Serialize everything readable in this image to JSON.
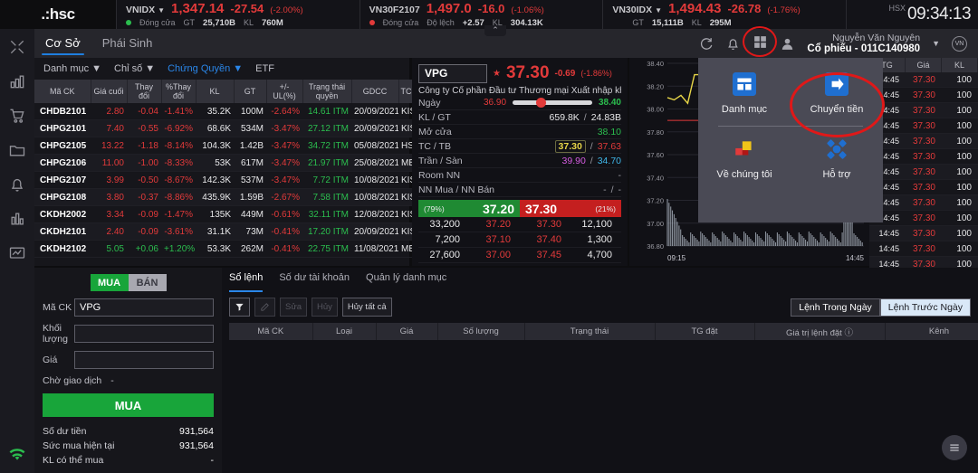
{
  "brand": {
    "logo": ".:hsc"
  },
  "indices": [
    {
      "name": "VNIDX",
      "value": "1,347.14",
      "change": "-27.54",
      "pct": "(-2.00%)",
      "status": "Đóng cửa",
      "status_color": "#2bbd4e",
      "m1_label": "GT",
      "m1_value": "25,710B",
      "m2_label": "KL",
      "m2_value": "760M",
      "dir": "down"
    },
    {
      "name": "VN30F2107",
      "value": "1,497.0",
      "change": "-16.0",
      "pct": "(-1.06%)",
      "status": "Đóng cửa",
      "status_color": "#e23a3a",
      "m1_label": "Độ lệch",
      "m1_value": "+2.57",
      "m2_label": "KL",
      "m2_value": "304.13K",
      "dir": "down"
    },
    {
      "name": "VN30IDX",
      "value": "1,494.43",
      "change": "-26.78",
      "pct": "(-1.76%)",
      "status": "",
      "status_color": "",
      "m1_label": "GT",
      "m1_value": "15,111B",
      "m2_label": "KL",
      "m2_value": "295M",
      "dir": "down"
    }
  ],
  "clock": {
    "exchange": "HSX",
    "time": "09:34:13"
  },
  "rail_icons": [
    "resize-icon",
    "chart-bar-icon",
    "cart-icon",
    "folder-icon",
    "bell-icon",
    "stats-icon",
    "monitor-icon",
    "wifi-icon"
  ],
  "header": {
    "tabs": [
      {
        "label": "Cơ Sở",
        "active": true
      },
      {
        "label": "Phái Sinh",
        "active": false
      }
    ],
    "account_name": "Nguyễn Văn Nguyên",
    "account_id": "Cổ phiếu - 011C140980",
    "avatar_initials": "VN"
  },
  "watchlist": {
    "tabs": [
      {
        "label": "Danh mục",
        "active": false,
        "caret": true
      },
      {
        "label": "Chỉ số",
        "active": false,
        "caret": true
      },
      {
        "label": "Chứng Quyền",
        "active": true,
        "caret": true
      },
      {
        "label": "ETF",
        "active": false,
        "caret": false
      }
    ],
    "columns": [
      "Mã CK",
      "Giá cuối",
      "Thay đổi",
      "%Thay đổi",
      "KL",
      "GT",
      "+/- UL(%)",
      "Trạng thái quyền",
      "GDCC",
      "TCPH"
    ],
    "rows": [
      {
        "sym": "CHDB2101",
        "last": "2.80",
        "chg": "-0.04",
        "pct": "-1.41%",
        "kl": "35.2K",
        "gt": "100M",
        "ul": "-2.64%",
        "status": "14.61 ITM",
        "gdcc": "20/09/2021",
        "tcph": "KIS",
        "dir": "down"
      },
      {
        "sym": "CHPG2101",
        "last": "7.40",
        "chg": "-0.55",
        "pct": "-6.92%",
        "kl": "68.6K",
        "gt": "534M",
        "ul": "-3.47%",
        "status": "27.12 ITM",
        "gdcc": "20/09/2021",
        "tcph": "KIS",
        "dir": "down"
      },
      {
        "sym": "CHPG2105",
        "last": "13.22",
        "chg": "-1.18",
        "pct": "-8.14%",
        "kl": "104.3K",
        "gt": "1.42B",
        "ul": "-3.47%",
        "status": "34.72 ITM",
        "gdcc": "05/08/2021",
        "tcph": "HSC",
        "dir": "down"
      },
      {
        "sym": "CHPG2106",
        "last": "11.00",
        "chg": "-1.00",
        "pct": "-8.33%",
        "kl": "53K",
        "gt": "617M",
        "ul": "-3.47%",
        "status": "21.97 ITM",
        "gdcc": "25/08/2021",
        "tcph": "MBS",
        "dir": "down"
      },
      {
        "sym": "CHPG2107",
        "last": "3.99",
        "chg": "-0.50",
        "pct": "-8.67%",
        "kl": "142.3K",
        "gt": "537M",
        "ul": "-3.47%",
        "status": "7.72 ITM",
        "gdcc": "10/08/2021",
        "tcph": "KIS",
        "dir": "down"
      },
      {
        "sym": "CHPG2108",
        "last": "3.80",
        "chg": "-0.37",
        "pct": "-8.86%",
        "kl": "435.9K",
        "gt": "1.59B",
        "ul": "-2.67%",
        "status": "7.58 ITM",
        "gdcc": "10/08/2021",
        "tcph": "KIS",
        "dir": "down"
      },
      {
        "sym": "CKDH2002",
        "last": "3.34",
        "chg": "-0.09",
        "pct": "-1.47%",
        "kl": "135K",
        "gt": "449M",
        "ul": "-0.61%",
        "status": "32.11 ITM",
        "gdcc": "12/08/2021",
        "tcph": "KIS",
        "dir": "down"
      },
      {
        "sym": "CKDH2101",
        "last": "2.40",
        "chg": "-0.09",
        "pct": "-3.61%",
        "kl": "31.1K",
        "gt": "73M",
        "ul": "-0.41%",
        "status": "17.20 ITM",
        "gdcc": "20/09/2021",
        "tcph": "KIS",
        "dir": "down"
      },
      {
        "sym": "CKDH2102",
        "last": "5.05",
        "chg": "+0.06",
        "pct": "+1.20%",
        "kl": "53.3K",
        "gt": "262M",
        "ul": "-0.41%",
        "status": "22.75 ITM",
        "gdcc": "11/08/2021",
        "tcph": "MBS",
        "dir": "up"
      }
    ]
  },
  "quote": {
    "symbol": "VPG",
    "price": "37.30",
    "change": "-0.69",
    "pct": "(-1.86%)",
    "company": "Công ty Cổ phần Đầu tư Thương mại Xuất nhập khẩ ...",
    "range_label": "Ngày",
    "range_low": "36.90",
    "range_high": "38.40",
    "range_pos_pct": 29,
    "kl_gt_label": "KL / GT",
    "kl": "659.8K",
    "gt": "24.83B",
    "open_label": "Mở cửa",
    "open": "38.10",
    "tc_tb_label": "TC / TB",
    "tc": "37.30",
    "tb": "37.63",
    "tran_san_label": "Trần / Sàn",
    "tran": "39.90",
    "san": "34.70",
    "room_label": "Room NN",
    "room": "-",
    "nn_label": "NN Mua / NN Bán",
    "nn_mua": "-",
    "nn_ban": "-",
    "bid_pct": "(79%)",
    "bid_price": "37.20",
    "ask_price": "37.30",
    "ask_pct": "(21%)",
    "depth": [
      {
        "bid_vol": "33,200",
        "bid_px": "37.20",
        "ask_px": "37.30",
        "ask_vol": "12,100"
      },
      {
        "bid_vol": "7,200",
        "bid_px": "37.10",
        "ask_px": "37.40",
        "ask_vol": "1,300"
      },
      {
        "bid_vol": "27,600",
        "bid_px": "37.00",
        "ask_px": "37.45",
        "ask_vol": "4,700"
      }
    ]
  },
  "chart_data": {
    "type": "line",
    "title": "",
    "xlabel": "",
    "ylabel": "",
    "x_ticks": [
      "09:15",
      "14:45"
    ],
    "y_ticks": [
      "38.40",
      "38.20",
      "38.00",
      "37.80",
      "37.60",
      "37.40",
      "37.20",
      "37.00",
      "36.80"
    ],
    "ylim": [
      36.8,
      38.4
    ],
    "reference_line": 37.9,
    "series": [
      {
        "name": "Giá",
        "color": "#e8d648",
        "values": [
          38.1,
          38.08,
          38.12,
          38.05,
          38.3,
          38.3,
          38.1,
          38.05,
          38.12,
          38.2,
          38.4,
          38.4,
          38.4,
          37.95,
          38.35,
          38.38,
          38.0,
          37.92,
          37.88,
          37.9,
          37.9,
          37.91,
          37.9,
          37.9,
          37.9,
          37.9,
          37.9,
          37.9,
          37.9,
          37.9
        ]
      }
    ],
    "volume_color": "#b9c3cf",
    "grid": true
  },
  "tape": {
    "columns": [
      "TG",
      "Giá",
      "KL"
    ],
    "rows": [
      {
        "time": "14:45",
        "price": "37.30",
        "vol": "100"
      },
      {
        "time": "14:45",
        "price": "37.30",
        "vol": "100"
      },
      {
        "time": "14:45",
        "price": "37.30",
        "vol": "100"
      },
      {
        "time": "14:45",
        "price": "37.30",
        "vol": "100"
      },
      {
        "time": "14:45",
        "price": "37.30",
        "vol": "100"
      },
      {
        "time": "14:45",
        "price": "37.30",
        "vol": "100"
      },
      {
        "time": "14:45",
        "price": "37.30",
        "vol": "100"
      },
      {
        "time": "14:45",
        "price": "37.30",
        "vol": "100"
      },
      {
        "time": "14:45",
        "price": "37.30",
        "vol": "100"
      },
      {
        "time": "14:45",
        "price": "37.30",
        "vol": "100"
      },
      {
        "time": "14:45",
        "price": "37.30",
        "vol": "100"
      },
      {
        "time": "14:45",
        "price": "37.30",
        "vol": "100"
      },
      {
        "time": "14:45",
        "price": "37.30",
        "vol": "100"
      }
    ]
  },
  "popup": {
    "items": [
      {
        "label": "Danh mục",
        "icon": "portfolio-icon"
      },
      {
        "label": "Chuyển tiền",
        "icon": "transfer-icon"
      },
      {
        "label": "Về chúng tôi",
        "icon": "about-icon"
      },
      {
        "label": "Hỗ trợ",
        "icon": "support-icon"
      }
    ]
  },
  "ticket": {
    "buy_label": "MUA",
    "sell_label": "BÁN",
    "symbol_label": "Mã CK",
    "symbol_value": "VPG",
    "qty_label": "Khối lượng",
    "qty_value": "",
    "price_label": "Giá",
    "price_value": "",
    "pending_label": "Chờ giao dịch",
    "pending_value": "-",
    "submit_label": "MUA",
    "summary": [
      {
        "label": "Số dư tiền",
        "value": "931,564"
      },
      {
        "label": "Sức mua hiện tại",
        "value": "931,564"
      },
      {
        "label": "KL có thể mua",
        "value": "-"
      }
    ]
  },
  "orderbook": {
    "tabs": [
      {
        "label": "Sổ lệnh",
        "active": true
      },
      {
        "label": "Số dư tài khoản",
        "active": false
      },
      {
        "label": "Quản lý danh mục",
        "active": false
      }
    ],
    "toolbar": [
      {
        "label": "filter-icon",
        "disabled": false
      },
      {
        "label": "edit-icon",
        "disabled": true
      },
      {
        "label": "Sửa",
        "disabled": true
      },
      {
        "label": "Hủy",
        "disabled": true
      },
      {
        "label": "Hủy tất cả",
        "disabled": false
      }
    ],
    "range_today": "Lệnh Trong Ngày",
    "range_prev": "Lệnh Trước Ngày",
    "columns": [
      "Mã CK",
      "Loại",
      "Giá",
      "Số lượng",
      "Trạng thái",
      "TG đặt",
      "Giá trị lệnh đặt ⓘ",
      "Kênh"
    ]
  },
  "fab": {
    "icon": "menu-icon"
  }
}
